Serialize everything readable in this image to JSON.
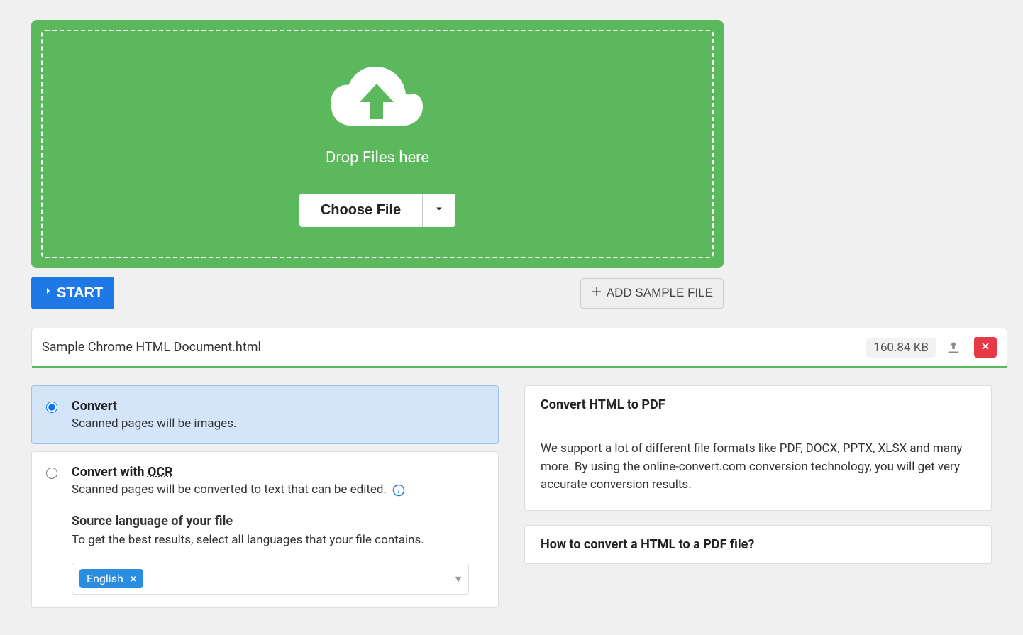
{
  "dropzone": {
    "drop_text": "Drop Files here",
    "choose_file_label": "Choose File"
  },
  "toolbar": {
    "start_label": "START",
    "add_sample_label": "ADD SAMPLE FILE"
  },
  "file": {
    "name": "Sample Chrome HTML Document.html",
    "size": "160.84 KB"
  },
  "options": {
    "convert": {
      "title": "Convert",
      "desc": "Scanned pages will be images."
    },
    "convert_ocr": {
      "title_prefix": "Convert with ",
      "title_ocr": "OCR",
      "desc": "Scanned pages will be converted to text that can be edited.",
      "source_label": "Source language of your file",
      "source_desc": "To get the best results, select all languages that your file contains.",
      "language_tag": "English"
    }
  },
  "info": {
    "card1": {
      "title": "Convert HTML to PDF",
      "body": "We support a lot of different file formats like PDF, DOCX, PPTX, XLSX and many more. By using the online-convert.com conversion technology, you will get very accurate conversion results."
    },
    "card2": {
      "title": "How to convert a HTML to a PDF file?"
    }
  }
}
